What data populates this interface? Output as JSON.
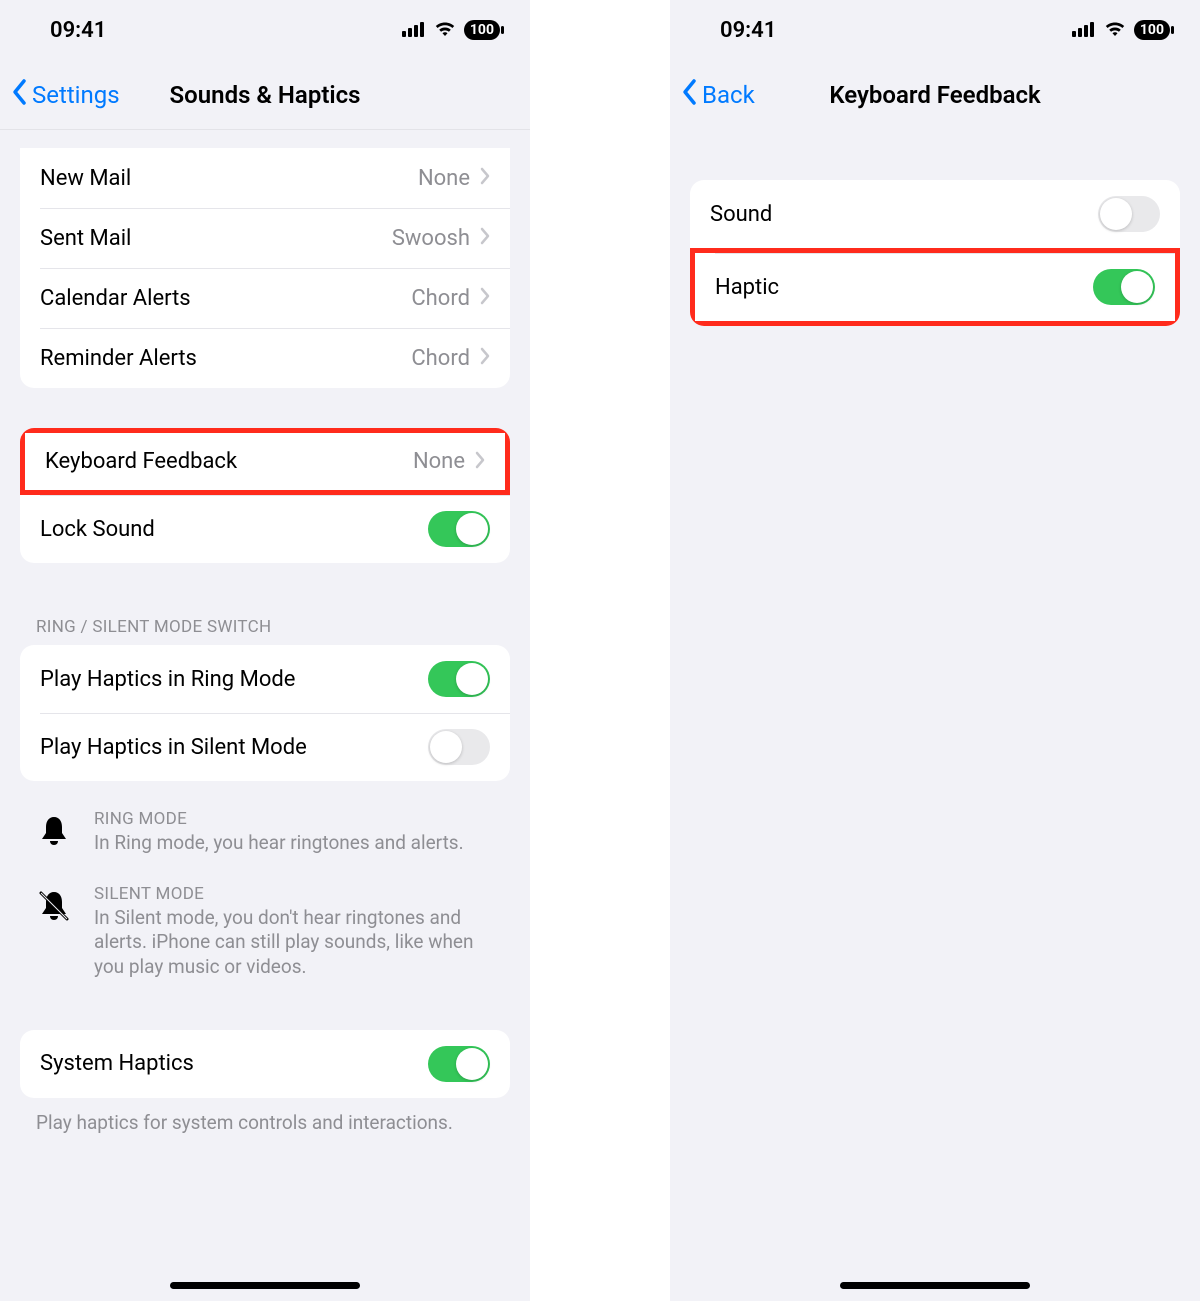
{
  "status": {
    "time": "09:41",
    "battery": "100"
  },
  "left": {
    "back_label": "Settings",
    "title": "Sounds & Haptics",
    "group1": {
      "new_mail": {
        "label": "New Mail",
        "value": "None"
      },
      "sent_mail": {
        "label": "Sent Mail",
        "value": "Swoosh"
      },
      "calendar_alerts": {
        "label": "Calendar Alerts",
        "value": "Chord"
      },
      "reminder_alerts": {
        "label": "Reminder Alerts",
        "value": "Chord"
      }
    },
    "group2": {
      "keyboard_feedback": {
        "label": "Keyboard Feedback",
        "value": "None"
      },
      "lock_sound": {
        "label": "Lock Sound"
      }
    },
    "group3_header": "RING / SILENT MODE SWITCH",
    "group3": {
      "ring_haptics": {
        "label": "Play Haptics in Ring Mode"
      },
      "silent_haptics": {
        "label": "Play Haptics in Silent Mode"
      }
    },
    "info_ring": {
      "title": "RING MODE",
      "desc": "In Ring mode, you hear ringtones and alerts."
    },
    "info_silent": {
      "title": "SILENT MODE",
      "desc": "In Silent mode, you don't hear ringtones and alerts. iPhone can still play sounds, like when you play music or videos."
    },
    "group4": {
      "system_haptics": {
        "label": "System Haptics"
      }
    },
    "group4_footer": "Play haptics for system controls and interactions."
  },
  "right": {
    "back_label": "Back",
    "title": "Keyboard Feedback",
    "rows": {
      "sound": {
        "label": "Sound"
      },
      "haptic": {
        "label": "Haptic"
      }
    }
  },
  "toggles": {
    "lock_sound": true,
    "ring_haptics": true,
    "silent_haptics": false,
    "system_haptics": true,
    "kb_sound": false,
    "kb_haptic": true
  },
  "colors": {
    "accent": "#007aff",
    "switch_on": "#34c759",
    "highlight": "#ff2b1c",
    "secondary": "#8e8e93"
  }
}
